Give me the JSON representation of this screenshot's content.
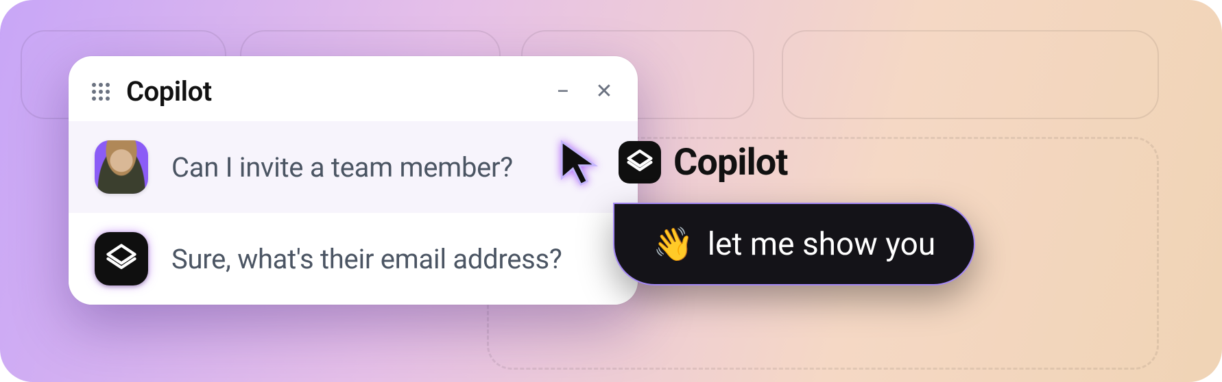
{
  "window": {
    "title": "Copilot",
    "minimize_glyph": "−",
    "close_glyph": "✕"
  },
  "messages": {
    "user_text": "Can I invite a team member?",
    "bot_text": "Sure, what's their email address?"
  },
  "cursor": {
    "label": "Copilot",
    "bubble_emoji": "👋",
    "bubble_text": "let me show you"
  },
  "colors": {
    "accent": "#8b5cf6",
    "dark": "#0f0f0f"
  }
}
